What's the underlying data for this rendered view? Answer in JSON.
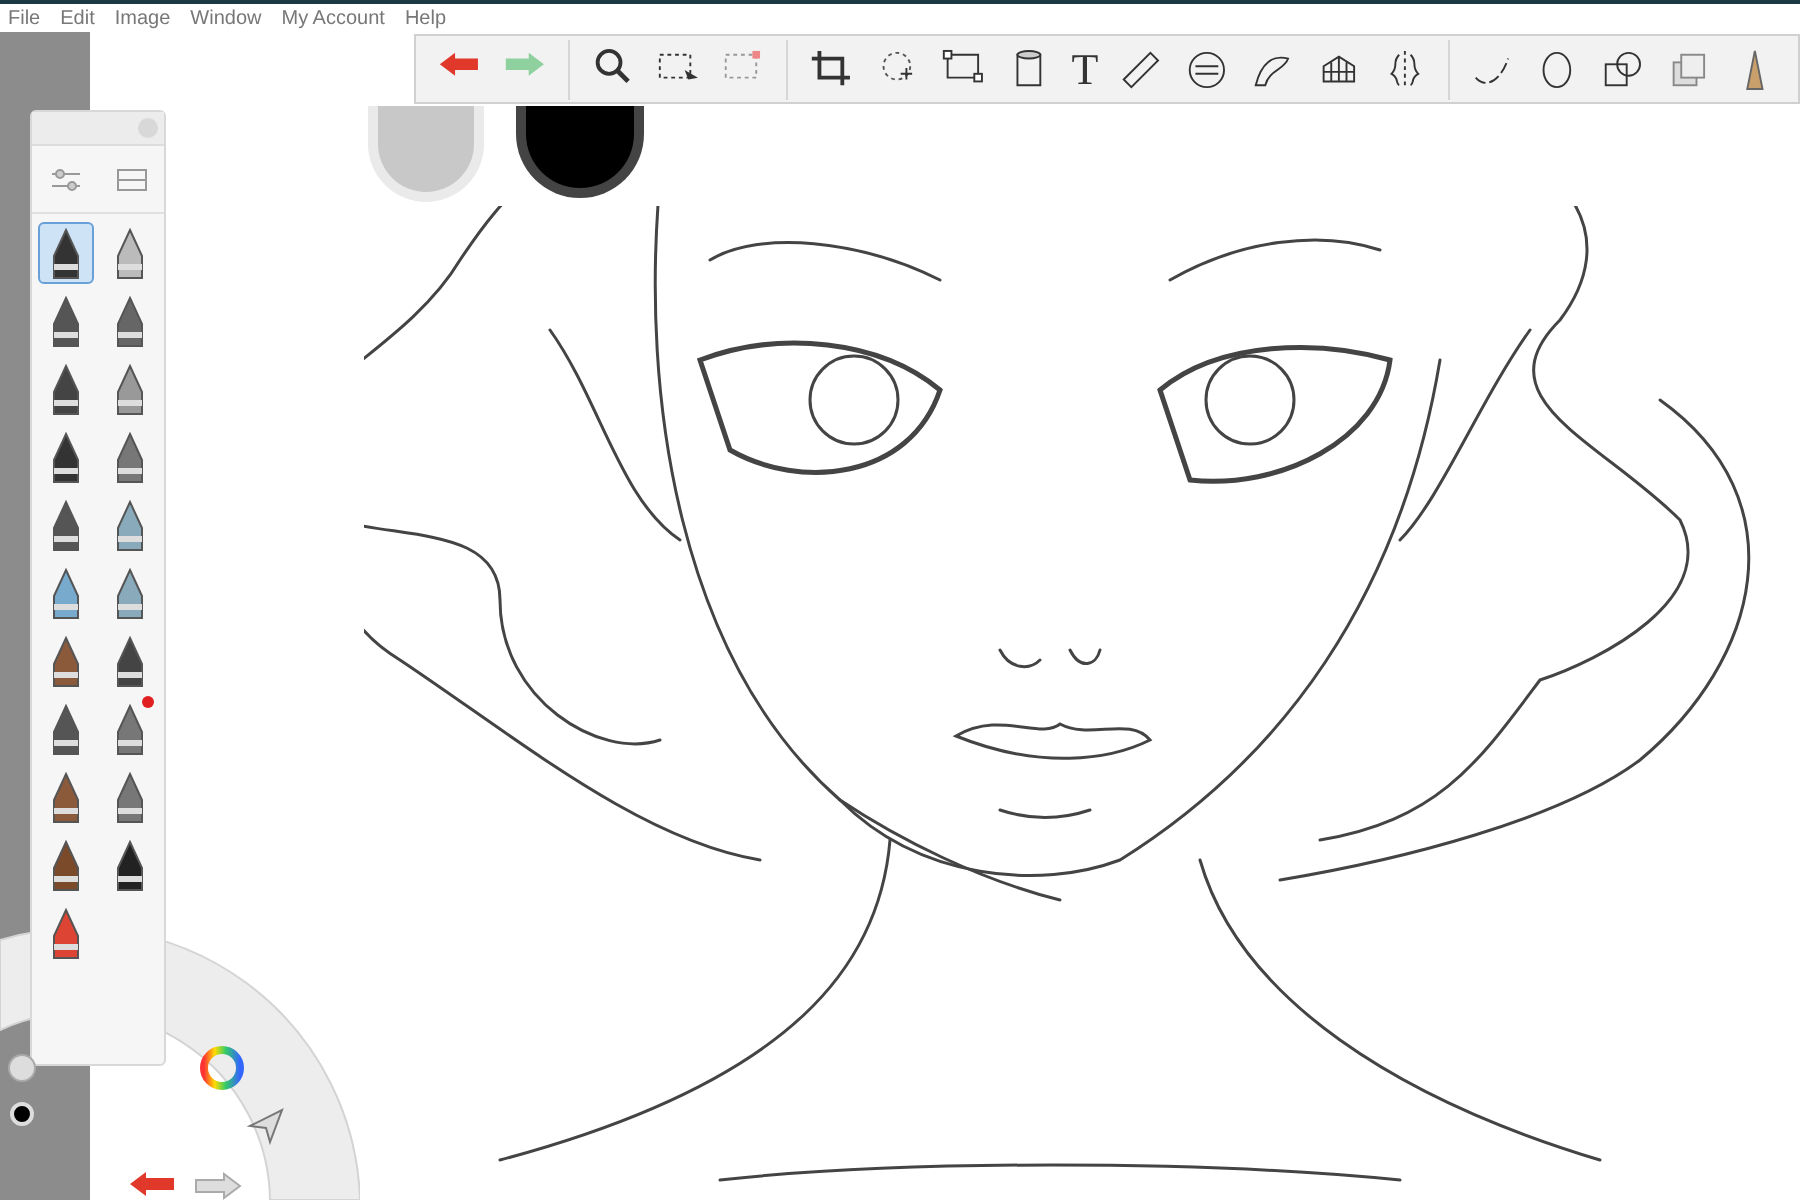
{
  "menu": [
    "File",
    "Edit",
    "Image",
    "Window",
    "My Account",
    "Help"
  ],
  "brushes": [
    {
      "selected": true,
      "new": false
    },
    {
      "selected": false,
      "new": false
    },
    {
      "selected": false,
      "new": false
    },
    {
      "selected": false,
      "new": false
    },
    {
      "selected": false,
      "new": false
    },
    {
      "selected": false,
      "new": false
    },
    {
      "selected": false,
      "new": false
    },
    {
      "selected": false,
      "new": false
    },
    {
      "selected": false,
      "new": false
    },
    {
      "selected": false,
      "new": false
    },
    {
      "selected": false,
      "new": false
    },
    {
      "selected": false,
      "new": false
    },
    {
      "selected": false,
      "new": false
    },
    {
      "selected": false,
      "new": false
    },
    {
      "selected": false,
      "new": false
    },
    {
      "selected": false,
      "new": true
    },
    {
      "selected": false,
      "new": false
    },
    {
      "selected": false,
      "new": false
    },
    {
      "selected": false,
      "new": false
    },
    {
      "selected": false,
      "new": false
    },
    {
      "selected": false,
      "new": false
    }
  ],
  "toolbar": {
    "text_tool": "T"
  },
  "colors": [
    {
      "color": "#c8c8c8"
    },
    {
      "color": "#000000"
    }
  ]
}
